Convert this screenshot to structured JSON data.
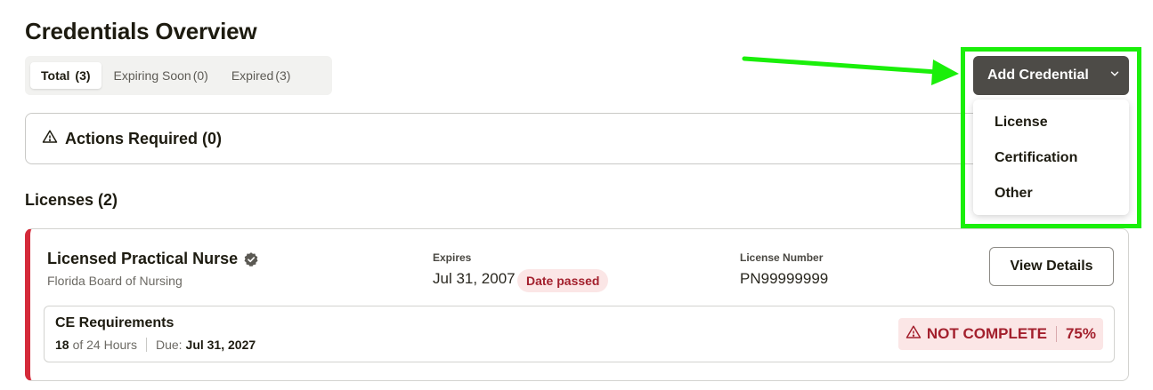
{
  "page": {
    "title": "Credentials Overview"
  },
  "filters": [
    {
      "label": "Total",
      "count": "(3)"
    },
    {
      "label": "Expiring Soon",
      "count": "(0)"
    },
    {
      "label": "Expired",
      "count": "(3)"
    }
  ],
  "actions": {
    "title": "Actions Required (0)"
  },
  "add_credential": {
    "label": "Add Credential",
    "menu": [
      "License",
      "Certification",
      "Other"
    ]
  },
  "licenses": {
    "section_title": "Licenses (2)",
    "items": [
      {
        "name": "Licensed Practical Nurse",
        "board": "Florida Board of Nursing",
        "expires_label": "Expires",
        "expires_value": "Jul 31, 2007",
        "expiry_badge": "Date passed",
        "number_label": "License Number",
        "number_value": "PN99999999",
        "view_button": "View Details",
        "ce": {
          "title": "CE Requirements",
          "hours_done": "18",
          "hours_total": "of 24 Hours",
          "due_label": "Due:",
          "due_value": "Jul 31, 2027",
          "status": "NOT COMPLETE",
          "percent": "75%"
        }
      }
    ]
  },
  "colors": {
    "accent_red": "#d42a3a",
    "button_dark": "#4d4b47",
    "highlight_green": "#1aef0a"
  }
}
